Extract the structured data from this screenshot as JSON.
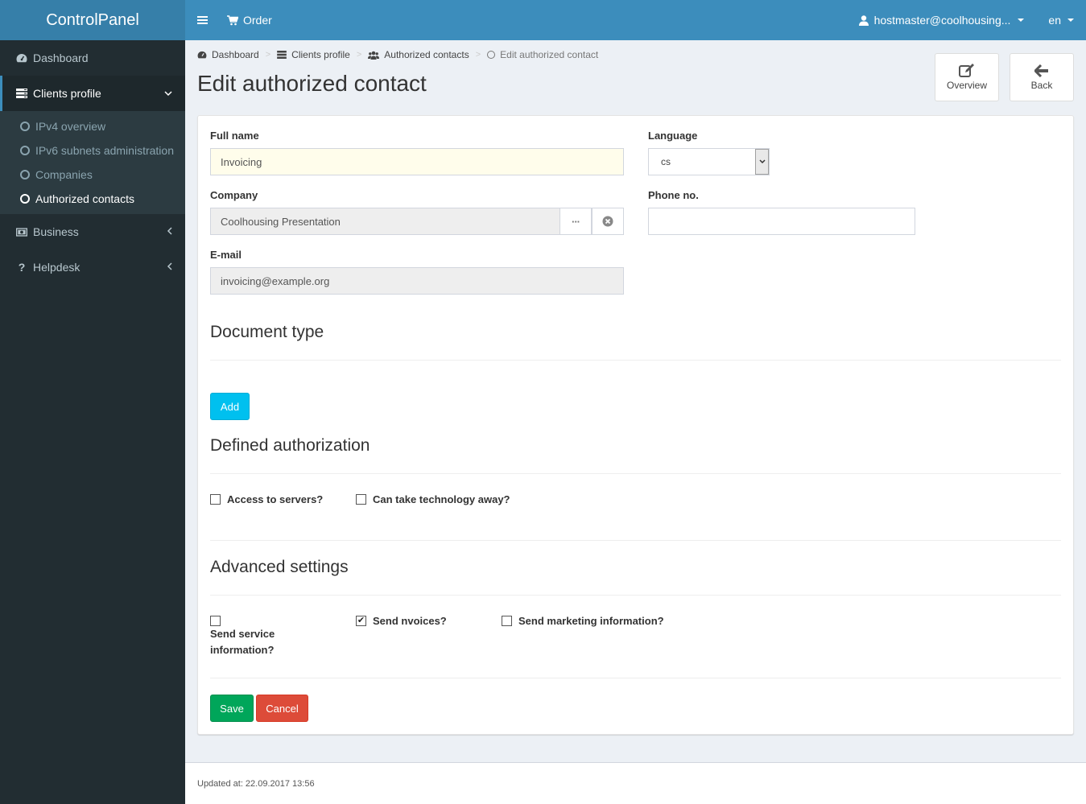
{
  "app": {
    "title": "ControlPanel"
  },
  "topnav": {
    "order_label": "Order",
    "user_label": "hostmaster@coolhousing...",
    "lang_label": "en"
  },
  "sidebar": {
    "items": [
      {
        "label": "Dashboard",
        "icon": "dashboard-icon"
      },
      {
        "label": "Clients profile",
        "icon": "list-icon",
        "active": true,
        "children": [
          {
            "label": "IPv4 overview"
          },
          {
            "label": "IPv6 subnets administration"
          },
          {
            "label": "Companies"
          },
          {
            "label": "Authorized contacts",
            "active": true
          }
        ]
      },
      {
        "label": "Business",
        "icon": "money-icon"
      },
      {
        "label": "Helpdesk",
        "icon": "question-icon"
      }
    ]
  },
  "breadcrumb": [
    {
      "label": "Dashboard",
      "icon": "dashboard-icon"
    },
    {
      "label": "Clients profile",
      "icon": "list-icon"
    },
    {
      "label": "Authorized contacts",
      "icon": "users-icon"
    },
    {
      "label": "Edit authorized contact",
      "icon": "circle-icon"
    }
  ],
  "page": {
    "title": "Edit authorized contact",
    "overview_label": "Overview",
    "back_label": "Back"
  },
  "form": {
    "full_name": {
      "label": "Full name",
      "value": "Invoicing"
    },
    "company": {
      "label": "Company",
      "value": "Coolhousing Presentation"
    },
    "email": {
      "label": "E-mail",
      "value": "invoicing@example.org"
    },
    "language": {
      "label": "Language",
      "value": "cs"
    },
    "phone": {
      "label": "Phone no.",
      "value": ""
    }
  },
  "document_type": {
    "title": "Document type",
    "add_label": "Add"
  },
  "defined_authorization": {
    "title": "Defined authorization",
    "options": [
      {
        "label": "Access to servers?",
        "checked": false
      },
      {
        "label": "Can take technology away?",
        "checked": false
      }
    ]
  },
  "advanced_settings": {
    "title": "Advanced settings",
    "options": [
      {
        "label": "Send service information?",
        "checked": false
      },
      {
        "label": "Send nvoices?",
        "checked": true
      },
      {
        "label": "Send marketing information?",
        "checked": false
      }
    ]
  },
  "actions": {
    "save_label": "Save",
    "cancel_label": "Cancel"
  },
  "footer": {
    "updated": "Updated at: 22.09.2017 13:56"
  }
}
